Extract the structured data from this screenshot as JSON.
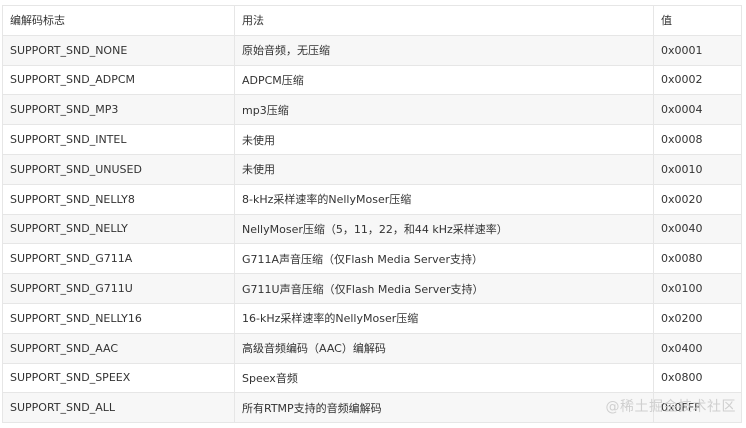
{
  "table": {
    "headers": [
      "编解码标志",
      "用法",
      "值"
    ],
    "rows": [
      {
        "flag": "SUPPORT_SND_NONE",
        "usage": "原始音频，无压缩",
        "value": "0x0001"
      },
      {
        "flag": "SUPPORT_SND_ADPCM",
        "usage": "ADPCM压缩",
        "value": "0x0002"
      },
      {
        "flag": "SUPPORT_SND_MP3",
        "usage": "mp3压缩",
        "value": "0x0004"
      },
      {
        "flag": "SUPPORT_SND_INTEL",
        "usage": "未使用",
        "value": "0x0008"
      },
      {
        "flag": "SUPPORT_SND_UNUSED",
        "usage": "未使用",
        "value": "0x0010"
      },
      {
        "flag": "SUPPORT_SND_NELLY8",
        "usage": "8-kHz采样速率的NellyMoser压缩",
        "value": "0x0020"
      },
      {
        "flag": "SUPPORT_SND_NELLY",
        "usage": "NellyMoser压缩（5，11，22，和44 kHz采样速率）",
        "value": "0x0040"
      },
      {
        "flag": "SUPPORT_SND_G711A",
        "usage": "G711A声音压缩（仅Flash Media Server支持）",
        "value": "0x0080"
      },
      {
        "flag": "SUPPORT_SND_G711U",
        "usage": "G711U声音压缩（仅Flash Media Server支持）",
        "value": "0x0100"
      },
      {
        "flag": "SUPPORT_SND_NELLY16",
        "usage": "16-kHz采样速率的NellyMoser压缩",
        "value": "0x0200"
      },
      {
        "flag": "SUPPORT_SND_AAC",
        "usage": "高级音频编码（AAC）编解码",
        "value": "0x0400"
      },
      {
        "flag": "SUPPORT_SND_SPEEX",
        "usage": "Speex音频",
        "value": "0x0800"
      },
      {
        "flag": "SUPPORT_SND_ALL",
        "usage": "所有RTMP支持的音频编解码",
        "value": "0x0FFF"
      }
    ]
  },
  "watermark": "@稀土掘金技术社区"
}
